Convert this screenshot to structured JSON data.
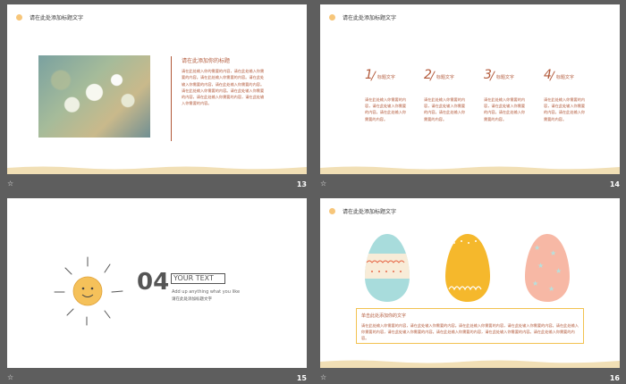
{
  "colors": {
    "background": "#5e5e5e",
    "accent": "#b2593a",
    "header_dot": "#f7c67a",
    "wave": "#f1dfb5",
    "egg_blue": "#a8dcdc",
    "egg_yellow": "#f5b82c",
    "egg_pink": "#f7b8a5"
  },
  "slides": [
    {
      "number": "13",
      "header_title": "请在此处添加标题文字",
      "photo_icon": "cherry-blossom-photo",
      "content_title": "请在此添加你的标题",
      "content_body": "请在此处输入你的需要的内容，请在此处输入你需要的内容。请在此处输入你需要的内容。请在此处输入你需要的内容，请在此处输入你需要的内容。请在此处输入你需要的内容。请在此处输入你需要的内容，请在此处输入你需要的内容，请在此处输入你需要的内容。"
    },
    {
      "number": "14",
      "header_title": "请在此处添加标题文字",
      "columns": [
        {
          "num": "1",
          "title": "标题文字",
          "body": "请在此处输入你需要的内容，请在此处输入你需要的内容。请在此处输入你需要的内容。"
        },
        {
          "num": "2",
          "title": "标题文字",
          "body": "请在此处输入你需要的内容，请在此处输入你需要的内容。请在此处输入你需要的内容。"
        },
        {
          "num": "3",
          "title": "标题文字",
          "body": "请在此处输入你需要的内容，请在此处输入你需要的内容。请在此处输入你需要的内容。"
        },
        {
          "num": "4",
          "title": "标题文字",
          "body": "请在此处输入你需要的内容，请在此处输入你需要的内容。请在此处输入你需要的内容。"
        }
      ]
    },
    {
      "number": "15",
      "section_number": "04",
      "box_text": "YOUR TEXT",
      "subtitle": "Add up anything  what you like",
      "subtitle_cn": "请在此处添加标题文字"
    },
    {
      "number": "16",
      "header_title": "请在此处添加标题文字",
      "box_title": "单击此处添加你的文字",
      "box_body": "请在此处输入你需要的内容，请在此处输入你需要的内容。请在此处输入你需要的内容，请在此处输入你需要的内容。请在此处输入你需要的内容，请在此处输入你需要的内容。请在此处输入你需要的内容，请在此处输入你需要的内容。请在此处输入你需要的内容。"
    }
  ],
  "meta_icon": "star-icon"
}
